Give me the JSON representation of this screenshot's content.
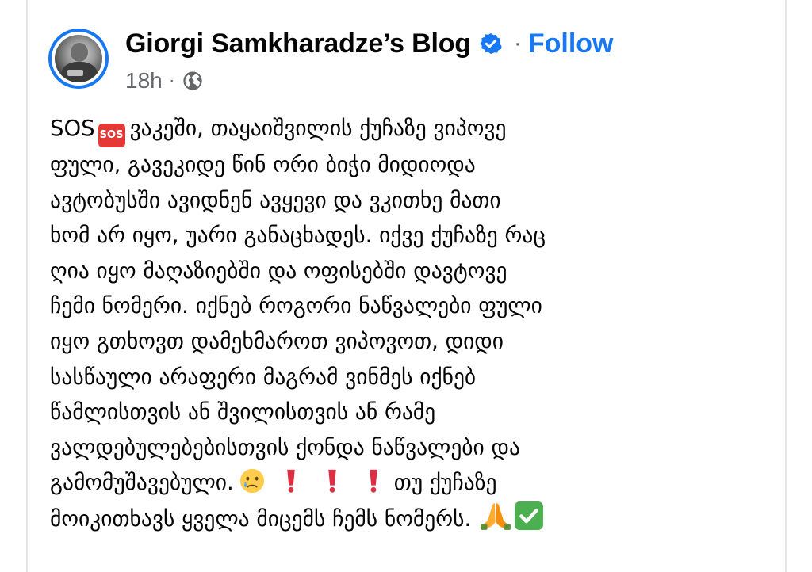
{
  "header": {
    "page_name": "Giorgi Samkharadze’s Blog",
    "separator": "·",
    "follow_label": "Follow",
    "timestamp": "18h",
    "meta_separator": "·",
    "icons": {
      "avatar": "profile-photo",
      "verified": "verified-badge-icon",
      "audience": "globe-icon"
    }
  },
  "post": {
    "segments": {
      "lead": "SOS",
      "sos_emoji_text": "SOS",
      "line1": "ვაკეში, თაყაიშვილის ქუჩაზე ვიპოვე",
      "line2": "ფული, გავეკიდე წინ ორი ბიჭი მიდიოდა",
      "line3": "ავტობუსში ავიდნენ ავყევი და ვკითხე მათი",
      "line4": "ხომ არ იყო, უარი განაცხადეს. იქვე ქუჩაზე რაც",
      "line5": "ღია იყო მაღაზიებში და ოფისებში დავტოვე",
      "line6": "ჩემი ნომერი. იქნებ როგორი ნაწვალები ფული",
      "line7": "იყო გთხოვთ დამეხმაროთ ვიპოვოთ, დიდი",
      "line8": "სასწაული არაფერი მაგრამ ვინმეს იქნებ",
      "line9": "წამლისთვის ან შვილისთვის ან რამე",
      "line10": "ვალდებულებებისთვის ქონდა ნაწვალები და",
      "line11a": "გამომუშავებული.",
      "line11b": "თუ ქუჩაზე",
      "line12": "მოიკითხავს ყველა მიცემს ჩემს ნომერს."
    },
    "emojis": [
      "sos-button-icon",
      "crying-face-icon",
      "exclamation-icon",
      "exclamation-icon",
      "exclamation-icon",
      "folded-hands-icon",
      "check-mark-button-icon"
    ]
  },
  "colors": {
    "accent": "#1877f2",
    "meta_text": "#65676b",
    "body_text": "#050505",
    "sos_red": "#e53935",
    "check_green": "#4caf50"
  }
}
